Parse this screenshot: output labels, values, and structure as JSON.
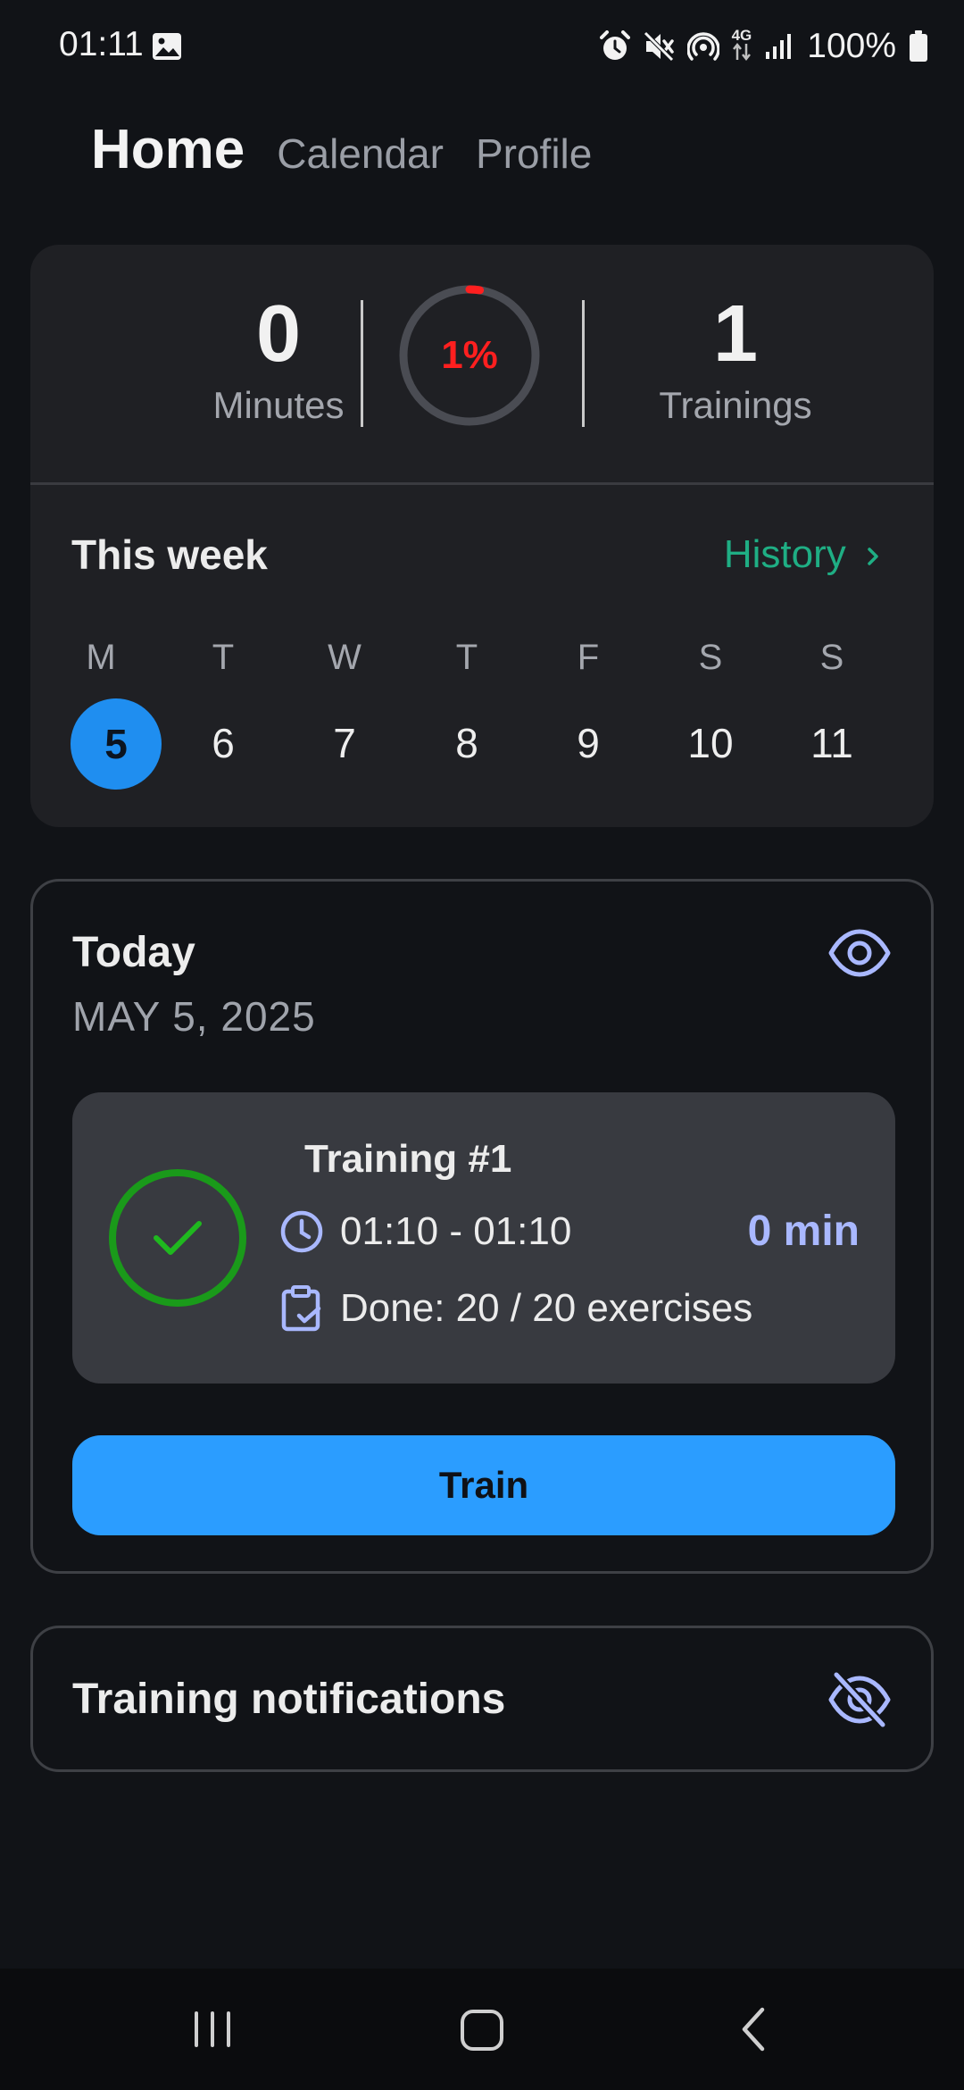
{
  "status_bar": {
    "time": "01:11",
    "network": "4G",
    "battery": "100%",
    "icons": [
      "gallery-icon",
      "alarm-icon",
      "mute-icon",
      "hotspot-icon",
      "data-arrows-icon",
      "signal-icon",
      "battery-icon"
    ]
  },
  "nav": {
    "tabs": [
      {
        "label": "Home",
        "active": true
      },
      {
        "label": "Calendar",
        "active": false
      },
      {
        "label": "Profile",
        "active": false
      }
    ]
  },
  "summary": {
    "minutes_value": "0",
    "minutes_label": "Minutes",
    "progress_label": "1%",
    "progress_fraction": 0.01,
    "trainings_value": "1",
    "trainings_label": "Trainings"
  },
  "week": {
    "title": "This week",
    "history_label": "History",
    "days": [
      {
        "letter": "M",
        "num": "5",
        "selected": true
      },
      {
        "letter": "T",
        "num": "6",
        "selected": false
      },
      {
        "letter": "W",
        "num": "7",
        "selected": false
      },
      {
        "letter": "T",
        "num": "8",
        "selected": false
      },
      {
        "letter": "F",
        "num": "9",
        "selected": false
      },
      {
        "letter": "S",
        "num": "10",
        "selected": false
      },
      {
        "letter": "S",
        "num": "11",
        "selected": false
      }
    ]
  },
  "today": {
    "title": "Today",
    "date": "MAY 5, 2025",
    "training": {
      "title": "Training #1",
      "time_range": "01:10 - 01:10",
      "duration": "0 min",
      "done": "Done: 20 / 20 exercises"
    },
    "train_button": "Train"
  },
  "notifications": {
    "title": "Training notifications"
  },
  "colors": {
    "background": "#111317",
    "card": "#1f2024",
    "accent_blue": "#2b9dff",
    "selected_day": "#1f8ef0",
    "history_green": "#1fae84",
    "progress_red": "#ff1f1f",
    "done_green": "#1a9a1a",
    "icon_lavender": "#a9b8ff"
  }
}
